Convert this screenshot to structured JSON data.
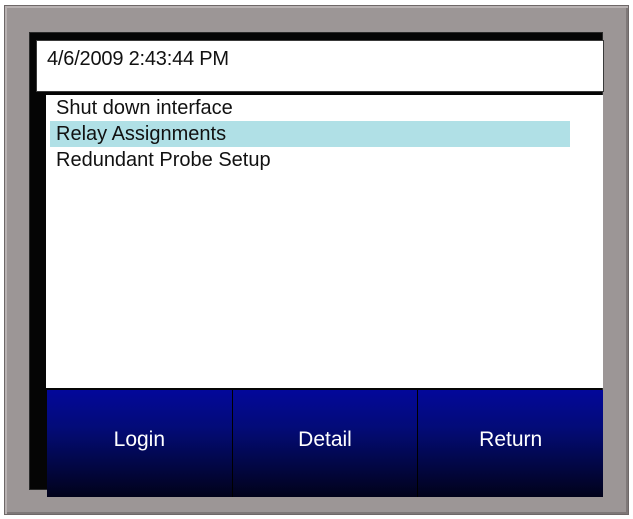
{
  "header": {
    "datetime": "4/6/2009 2:43:44 PM"
  },
  "menu": {
    "items": [
      {
        "label": "Shut down interface",
        "selected": false
      },
      {
        "label": "Relay Assignments",
        "selected": true
      },
      {
        "label": "Redundant Probe Setup",
        "selected": false
      }
    ],
    "selected_color": "#b0e0e6"
  },
  "buttons": {
    "login": "Login",
    "detail": "Detail",
    "return": "Return"
  },
  "colors": {
    "bezel": "#9c9696",
    "button_top": "#03089a",
    "button_bottom": "#01021a"
  }
}
